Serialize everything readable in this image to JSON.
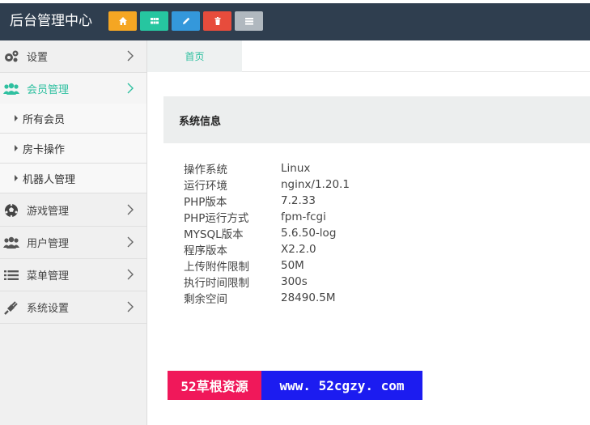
{
  "header": {
    "brand": "后台管理中心",
    "buttons": [
      {
        "name": "home",
        "icon": "home-icon",
        "color": "#f5a623"
      },
      {
        "name": "grid",
        "icon": "grid-icon",
        "color": "#26c6a0"
      },
      {
        "name": "edit",
        "icon": "pencil-icon",
        "color": "#3498db"
      },
      {
        "name": "delete",
        "icon": "trash-icon",
        "color": "#e74c3c"
      },
      {
        "name": "list",
        "icon": "list-icon",
        "color": "#b0b8bf"
      }
    ]
  },
  "sidebar": {
    "items": [
      {
        "label": "设置",
        "icon": "gears-icon"
      },
      {
        "label": "会员管理",
        "icon": "users-icon",
        "active": true
      },
      {
        "label": "游戏管理",
        "icon": "soccer-ball-icon"
      },
      {
        "label": "用户管理",
        "icon": "users-icon"
      },
      {
        "label": "菜单管理",
        "icon": "list-icon"
      },
      {
        "label": "系统设置",
        "icon": "plug-icon"
      }
    ],
    "subitems": [
      {
        "label": "所有会员"
      },
      {
        "label": "房卡操作"
      },
      {
        "label": "机器人管理"
      }
    ]
  },
  "tabs": [
    {
      "label": "首页"
    }
  ],
  "panel": {
    "title": "系统信息"
  },
  "sysinfo": [
    {
      "key": "操作系统",
      "value": "Linux"
    },
    {
      "key": "运行环境",
      "value": "nginx/1.20.1"
    },
    {
      "key": "PHP版本",
      "value": "7.2.33"
    },
    {
      "key": "PHP运行方式",
      "value": "fpm-fcgi"
    },
    {
      "key": "MYSQL版本",
      "value": "5.6.50-log"
    },
    {
      "key": "程序版本",
      "value": "X2.2.0"
    },
    {
      "key": "上传附件限制",
      "value": "50M"
    },
    {
      "key": "执行时间限制",
      "value": "300s"
    },
    {
      "key": "剩余空间",
      "value": "28490.5M"
    }
  ],
  "watermark": {
    "left": "52草根资源",
    "right": "www. 52cgzy. com"
  }
}
